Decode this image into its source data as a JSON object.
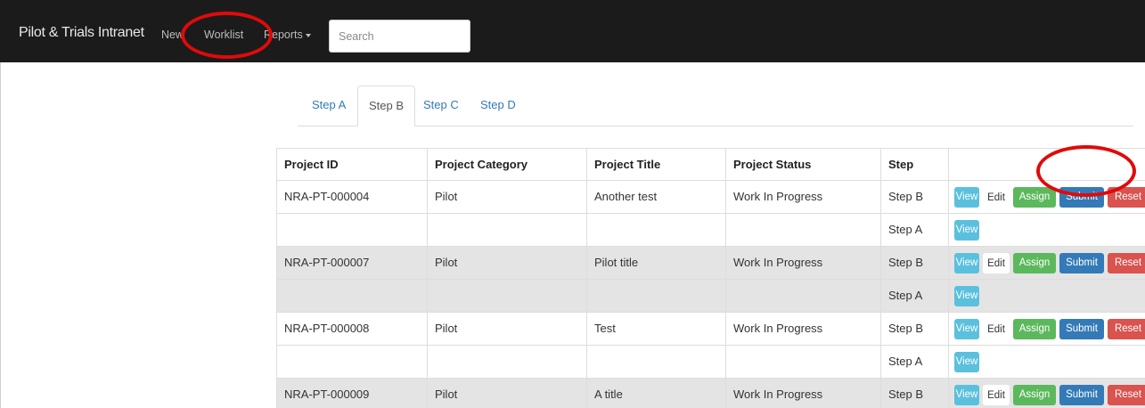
{
  "navbar": {
    "brand": "Pilot & Trials Intranet",
    "links": {
      "new": "New",
      "worklist": "Worklist",
      "reports": "Reports"
    }
  },
  "search": {
    "placeholder": "Search"
  },
  "tabs": [
    {
      "label": "Step A",
      "active": false
    },
    {
      "label": "Step B",
      "active": true
    },
    {
      "label": "Step C",
      "active": false
    },
    {
      "label": "Step D",
      "active": false
    }
  ],
  "table": {
    "headers": [
      "Project ID",
      "Project Category",
      "Project Title",
      "Project Status",
      "Step",
      ""
    ],
    "actions": {
      "view": "View",
      "edit": "Edit",
      "assign": "Assign",
      "submit": "Submit",
      "reset": "Reset"
    },
    "rows": [
      {
        "project_id": "NRA-PT-000004",
        "category": "Pilot",
        "title": "Another test",
        "status": "Work In Progress",
        "step": "Step B",
        "shaded": false,
        "full_actions": true
      },
      {
        "project_id": "",
        "category": "",
        "title": "",
        "status": "",
        "step": "Step A",
        "shaded": false,
        "full_actions": false
      },
      {
        "project_id": "NRA-PT-000007",
        "category": "Pilot",
        "title": "Pilot title",
        "status": "Work In Progress",
        "step": "Step B",
        "shaded": true,
        "full_actions": true
      },
      {
        "project_id": "",
        "category": "",
        "title": "",
        "status": "",
        "step": "Step A",
        "shaded": true,
        "full_actions": false
      },
      {
        "project_id": "NRA-PT-000008",
        "category": "Pilot",
        "title": "Test",
        "status": "Work In Progress",
        "step": "Step B",
        "shaded": false,
        "full_actions": true
      },
      {
        "project_id": "",
        "category": "",
        "title": "",
        "status": "",
        "step": "Step A",
        "shaded": false,
        "full_actions": false
      },
      {
        "project_id": "NRA-PT-000009",
        "category": "Pilot",
        "title": "A title",
        "status": "Work In Progress",
        "step": "Step B",
        "shaded": true,
        "full_actions": true
      }
    ]
  },
  "colors": {
    "navbar": "#1b1b1b",
    "annotation": "#e10a0a",
    "view": "#5bc0de",
    "assign": "#5cb85c",
    "submit": "#337ab7",
    "reset": "#d9534f",
    "shaded_row": "#e4e4e4"
  }
}
